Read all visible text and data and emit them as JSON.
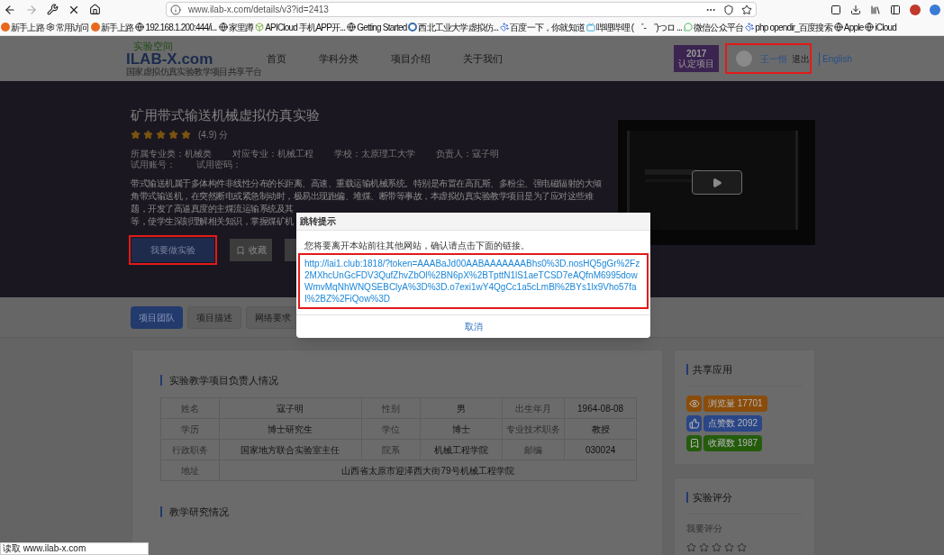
{
  "browser": {
    "url": "www.ilab-x.com/details/v3?id=2413",
    "bookmarks": [
      {
        "label": "新手上路",
        "kind": "fox"
      },
      {
        "label": "常用访问",
        "kind": "gear"
      },
      {
        "label": "新手上路",
        "kind": "fox"
      },
      {
        "label": "192.168.1.200:444/i...",
        "kind": "globe"
      },
      {
        "label": "家里蹲",
        "kind": "globe"
      },
      {
        "label": "APICloud 手机APP开...",
        "kind": "app"
      },
      {
        "label": "Getting Started",
        "kind": "globe"
      },
      {
        "label": "西北工业大学虚拟仿...",
        "kind": "seal"
      },
      {
        "label": "百度一下，你就知道",
        "kind": "paw"
      },
      {
        "label": "哔哩哔哩 ( ゜- ゜)つロ ...",
        "kind": "tv"
      },
      {
        "label": "微信公众平台",
        "kind": "chat"
      },
      {
        "label": "php opendir_百度搜索",
        "kind": "paw"
      },
      {
        "label": "Apple",
        "kind": "globe"
      },
      {
        "label": "iCloud",
        "kind": "globe"
      }
    ]
  },
  "header": {
    "logo_top": "实验空间",
    "logo_main": "ILAB-X.com",
    "logo_sub": "国家虚拟仿真实验教学项目共享平台",
    "nav": [
      "首页",
      "学科分类",
      "项目介绍",
      "关于我们"
    ],
    "badge_year": "2017",
    "badge_label": "认定项目",
    "user": "王一恒",
    "logout": "退出",
    "language": "English"
  },
  "hero": {
    "title": "矿用带式输送机械虚拟仿真实验",
    "stars": 5,
    "rating": "(4.9) 分",
    "info": [
      "所属专业类：机械类",
      "对应专业：机械工程",
      "学校：太原理工大学",
      "负责人：寇子明",
      "试用账号：",
      "试用密码："
    ],
    "description": [
      "带式输送机属于多体构件非线性分布的长距离、高速、重载运输机械系统。特别是布置在高瓦斯、多粉尘、强电磁辐射的大倾",
      "角带式输送机，在突然断电或紧急制动时，极易出现跑偏、堆煤、断带等事故，本虚拟仿真实验教学项目是为了应对这些难",
      "题，开发了高逼真度的主煤流运输系统及其",
      "等，使学生深刻理解相关知识，掌握煤矿机"
    ],
    "buttons": [
      {
        "label": "我要做实验",
        "kind": "primary"
      },
      {
        "label": "收藏",
        "kind": "bookmark"
      }
    ]
  },
  "dialog": {
    "title": "跳转提示",
    "message": "您将要离开本站前往其他网站，确认请点击下面的链接。",
    "link": "http://lai1.club:1818/?token=AAABaJd00AABAAAAAAABhs0%3D.nosHQ5gGr%2Fz2MXhcUnGcFDV3QufZhvZbOl%2BN6pX%2BTpttN1lS1aeTCSD7eAQfnM6995dowWmvMqNhWNQSEBClyA%3D%3D.o7exi1wY4QgCc1a5cLmBl%2BYs1lx9Vho57faI%2BZ%2FiQow%3D",
    "cancel": "取消"
  },
  "tabs": [
    {
      "label": "项目团队",
      "selected": true
    },
    {
      "label": "项目描述",
      "selected": false
    },
    {
      "label": "网络要求",
      "selected": false
    }
  ],
  "team": {
    "heading": "实验教学项目负责人情况",
    "rows": [
      [
        {
          "text": "姓名"
        },
        {
          "text": "寇子明"
        },
        {
          "text": "性别"
        },
        {
          "text": "男"
        },
        {
          "text": "出生年月"
        },
        {
          "text": "1964-08-08"
        }
      ],
      [
        {
          "text": "学历"
        },
        {
          "text": "博士研究生"
        },
        {
          "text": "学位"
        },
        {
          "text": "博士"
        },
        {
          "text": "专业技术职务"
        },
        {
          "text": "教授"
        }
      ],
      [
        {
          "text": "行政职务"
        },
        {
          "text": "国家地方联合实验室主任"
        },
        {
          "text": "院系"
        },
        {
          "text": "机械工程学院"
        },
        {
          "text": "邮编"
        },
        {
          "text": "030024"
        }
      ],
      [
        {
          "text": "地址"
        },
        {
          "text": "山西省太原市迎泽西大街79号机械工程学院",
          "colspan": 5
        }
      ]
    ],
    "heading2": "教学研究情况"
  },
  "share": {
    "heading": "共享应用",
    "stats": [
      {
        "label": "浏览量 17701",
        "kind": "eye",
        "color": "#8a4c0a"
      },
      {
        "label": "点赞数 2092",
        "kind": "like",
        "color": "#2a4687"
      },
      {
        "label": "收藏数 1987",
        "kind": "save",
        "color": "#245c0c"
      }
    ]
  },
  "rating": {
    "heading": "实验评分",
    "prompt": "我要评分",
    "stars": 0
  },
  "status_bar": "读取 www.ilab-x.com"
}
